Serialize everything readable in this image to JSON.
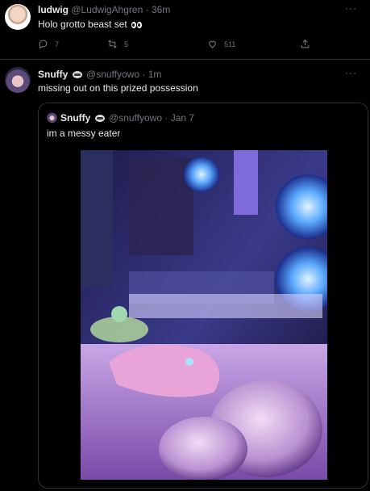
{
  "tweet1": {
    "display_name": "ludwig",
    "handle": "@LudwigAhgren",
    "time": "· 36m",
    "text": "Holo grotto beast set",
    "emoji_icon": "eyes-emoji",
    "replies": "7",
    "retweets": "5",
    "likes": "511",
    "more": "···"
  },
  "tweet2": {
    "display_name": "Snuffy",
    "badge_icon": "raccoon-emoji",
    "handle": "@snuffyowo",
    "time": "· 1m",
    "text": "missing out on this prized possession",
    "more": "···",
    "quote": {
      "display_name": "Snuffy",
      "badge_icon": "raccoon-emoji",
      "handle": "@snuffyowo",
      "time": "· Jan 7",
      "text": "im a messy eater"
    }
  },
  "colors": {
    "background": "#000000",
    "text": "#e7e9ea",
    "secondary": "#71767b",
    "border": "#2f3336"
  }
}
